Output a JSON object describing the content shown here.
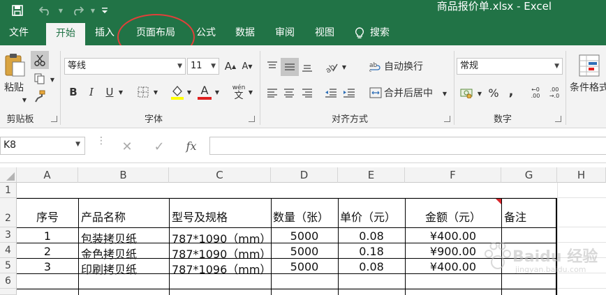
{
  "window": {
    "title": "商品报价单.xlsx  -  Excel"
  },
  "tabs": [
    {
      "label": "文件"
    },
    {
      "label": "开始"
    },
    {
      "label": "插入"
    },
    {
      "label": "页面布局"
    },
    {
      "label": "公式"
    },
    {
      "label": "数据"
    },
    {
      "label": "审阅"
    },
    {
      "label": "视图"
    },
    {
      "label": "搜索"
    }
  ],
  "ribbon": {
    "clipboard": {
      "paste_label": "粘贴",
      "group_label": "剪贴板"
    },
    "font": {
      "font_name": "等线",
      "font_size": "11",
      "group_label": "字体",
      "bold": "B",
      "italic": "I",
      "underline": "U",
      "font_color_letter": "A",
      "wen_top": "wén",
      "wen_bottom": "文"
    },
    "alignment": {
      "wrap_text": "自动换行",
      "merge_center": "合并后居中",
      "group_label": "对齐方式"
    },
    "number": {
      "format": "常规",
      "percent": "%",
      "comma": ",",
      "inc_decimal_top": "←0",
      "inc_decimal_bottom": ".00",
      "dec_decimal_top": ".00",
      "dec_decimal_bottom": "→.0",
      "group_label": "数字"
    },
    "styles": {
      "conditional_format": "条件格式"
    }
  },
  "formula_bar": {
    "name_box": "K8",
    "fx": "fx",
    "formula": ""
  },
  "sheet": {
    "columns": [
      "A",
      "B",
      "C",
      "D",
      "E",
      "F",
      "G",
      "H"
    ],
    "rows": [
      "1",
      "2",
      "3",
      "4",
      "5",
      "6"
    ],
    "header": [
      "序号",
      "产品名称",
      "型号及规格",
      "数量（张）",
      "单价（元）",
      "金额（元）",
      "备注"
    ],
    "data": [
      [
        "1",
        "包装拷贝纸",
        "787*1090（mm）",
        "5000",
        "0.08",
        "¥400.00",
        ""
      ],
      [
        "2",
        "金色拷贝纸",
        "787*1090（mm）",
        "5000",
        "0.18",
        "¥900.00",
        ""
      ],
      [
        "3",
        "印刷拷贝纸",
        "787*1096（mm）",
        "5000",
        "0.08",
        "¥400.00",
        ""
      ]
    ]
  },
  "watermark": {
    "text": "Baidu 经验",
    "url": "jingyan.baidu.com"
  },
  "colors": {
    "excel_green": "#217346",
    "highlight_yellow": "#ffff00",
    "font_red": "#e02020",
    "annotation_red": "#e0403a"
  }
}
